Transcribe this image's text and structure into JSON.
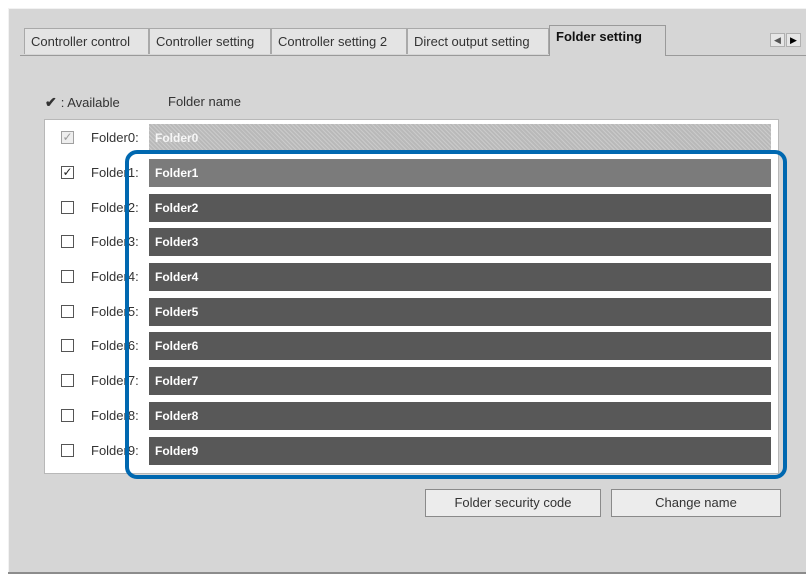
{
  "tabs": [
    {
      "label": "Controller control"
    },
    {
      "label": "Controller setting"
    },
    {
      "label": "Controller setting 2"
    },
    {
      "label": "Direct output setting"
    },
    {
      "label": "Folder setting"
    }
  ],
  "active_tab": "Folder setting",
  "header": {
    "check_mark": "✔",
    "available_label": ": Available",
    "folder_name_label": "Folder name"
  },
  "folders": [
    {
      "label": "Folder0:",
      "name": "Folder0",
      "checked": true,
      "disabled": true
    },
    {
      "label": "Folder1:",
      "name": "Folder1",
      "checked": true,
      "disabled": false
    },
    {
      "label": "Folder2:",
      "name": "Folder2",
      "checked": false,
      "disabled": false
    },
    {
      "label": "Folder3:",
      "name": "Folder3",
      "checked": false,
      "disabled": false
    },
    {
      "label": "Folder4:",
      "name": "Folder4",
      "checked": false,
      "disabled": false
    },
    {
      "label": "Folder5:",
      "name": "Folder5",
      "checked": false,
      "disabled": false
    },
    {
      "label": "Folder6:",
      "name": "Folder6",
      "checked": false,
      "disabled": false
    },
    {
      "label": "Folder7:",
      "name": "Folder7",
      "checked": false,
      "disabled": false
    },
    {
      "label": "Folder8:",
      "name": "Folder8",
      "checked": false,
      "disabled": false
    },
    {
      "label": "Folder9:",
      "name": "Folder9",
      "checked": false,
      "disabled": false
    }
  ],
  "buttons": {
    "security_code": "Folder security code",
    "change_name": "Change name"
  },
  "tab_scroll": {
    "left": "◀",
    "right": "▶"
  },
  "colors": {
    "highlight": "#0068b0",
    "folder_bar": "#585858"
  }
}
